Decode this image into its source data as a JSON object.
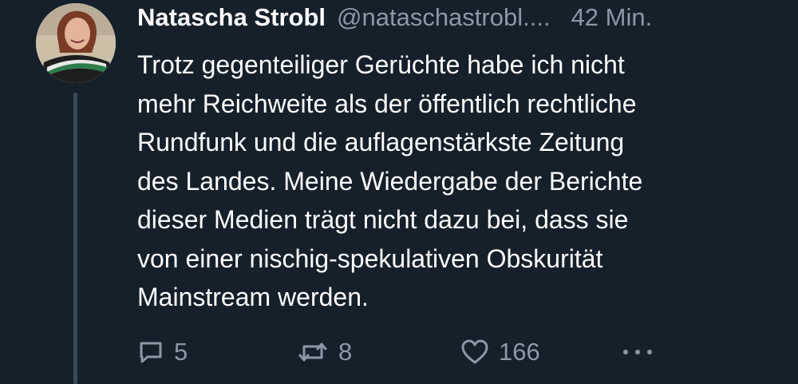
{
  "author": {
    "name": "Natascha Strobl",
    "handle": "@nataschastrobl....",
    "time": "42 Min."
  },
  "tweet_lines": [
    "Trotz gegenteiliger Gerüchte habe ich nicht",
    "mehr Reichweite als der öffentlich rechtliche",
    "Rundfunk und die auflagenstärkste Zeitung",
    "des Landes. Meine Wiedergabe der Berichte",
    "dieser Medien trägt nicht dazu bei, dass sie",
    "von einer nischig-spekulativen Obskurität",
    "Mainstream werden."
  ],
  "actions": {
    "replies": "5",
    "retweets": "8",
    "likes": "166"
  },
  "icons": {
    "reply": "reply-icon",
    "retweet": "retweet-icon",
    "like": "heart-icon",
    "more": "more-icon"
  },
  "colors": {
    "background": "#15202b",
    "text": "#ffffff",
    "secondary": "#8b98a5"
  }
}
